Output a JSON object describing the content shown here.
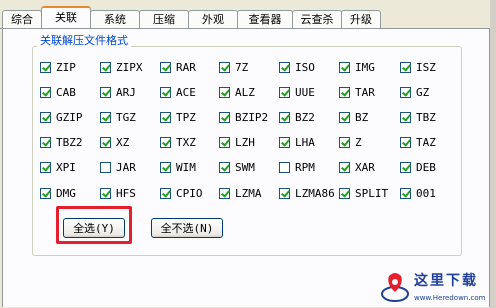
{
  "tabs": [
    {
      "label": "综合",
      "active": false
    },
    {
      "label": "关联",
      "active": true
    },
    {
      "label": "系统",
      "active": false
    },
    {
      "label": "压缩",
      "active": false
    },
    {
      "label": "外观",
      "active": false
    },
    {
      "label": "查看器",
      "active": false
    },
    {
      "label": "云查杀",
      "active": false
    },
    {
      "label": "升级",
      "active": false
    }
  ],
  "group_title": "关联解压文件格式",
  "formats": [
    {
      "label": "ZIP",
      "checked": true
    },
    {
      "label": "ZIPX",
      "checked": true
    },
    {
      "label": "RAR",
      "checked": true
    },
    {
      "label": "7Z",
      "checked": true
    },
    {
      "label": "ISO",
      "checked": true
    },
    {
      "label": "IMG",
      "checked": true
    },
    {
      "label": "ISZ",
      "checked": true
    },
    {
      "label": "CAB",
      "checked": true
    },
    {
      "label": "ARJ",
      "checked": true
    },
    {
      "label": "ACE",
      "checked": true
    },
    {
      "label": "ALZ",
      "checked": true
    },
    {
      "label": "UUE",
      "checked": true
    },
    {
      "label": "TAR",
      "checked": true
    },
    {
      "label": "GZ",
      "checked": true
    },
    {
      "label": "GZIP",
      "checked": true
    },
    {
      "label": "TGZ",
      "checked": true
    },
    {
      "label": "TPZ",
      "checked": true
    },
    {
      "label": "BZIP2",
      "checked": true
    },
    {
      "label": "BZ2",
      "checked": true
    },
    {
      "label": "BZ",
      "checked": true
    },
    {
      "label": "TBZ",
      "checked": true
    },
    {
      "label": "TBZ2",
      "checked": true
    },
    {
      "label": "XZ",
      "checked": true
    },
    {
      "label": "TXZ",
      "checked": true
    },
    {
      "label": "LZH",
      "checked": true
    },
    {
      "label": "LHA",
      "checked": true
    },
    {
      "label": "Z",
      "checked": true
    },
    {
      "label": "TAZ",
      "checked": true
    },
    {
      "label": "XPI",
      "checked": true
    },
    {
      "label": "JAR",
      "checked": false
    },
    {
      "label": "WIM",
      "checked": true
    },
    {
      "label": "SWM",
      "checked": true
    },
    {
      "label": "RPM",
      "checked": false
    },
    {
      "label": "XAR",
      "checked": true
    },
    {
      "label": "DEB",
      "checked": true
    },
    {
      "label": "DMG",
      "checked": true
    },
    {
      "label": "HFS",
      "checked": true
    },
    {
      "label": "CPIO",
      "checked": true
    },
    {
      "label": "LZMA",
      "checked": true
    },
    {
      "label": "LZMA86",
      "checked": true
    },
    {
      "label": "SPLIT",
      "checked": true
    },
    {
      "label": "001",
      "checked": true
    }
  ],
  "buttons": {
    "select_all": "全选(Y)",
    "select_none": "全不选(N)"
  },
  "watermark": {
    "text": "这里下载",
    "url": "www.Heredown.com"
  }
}
